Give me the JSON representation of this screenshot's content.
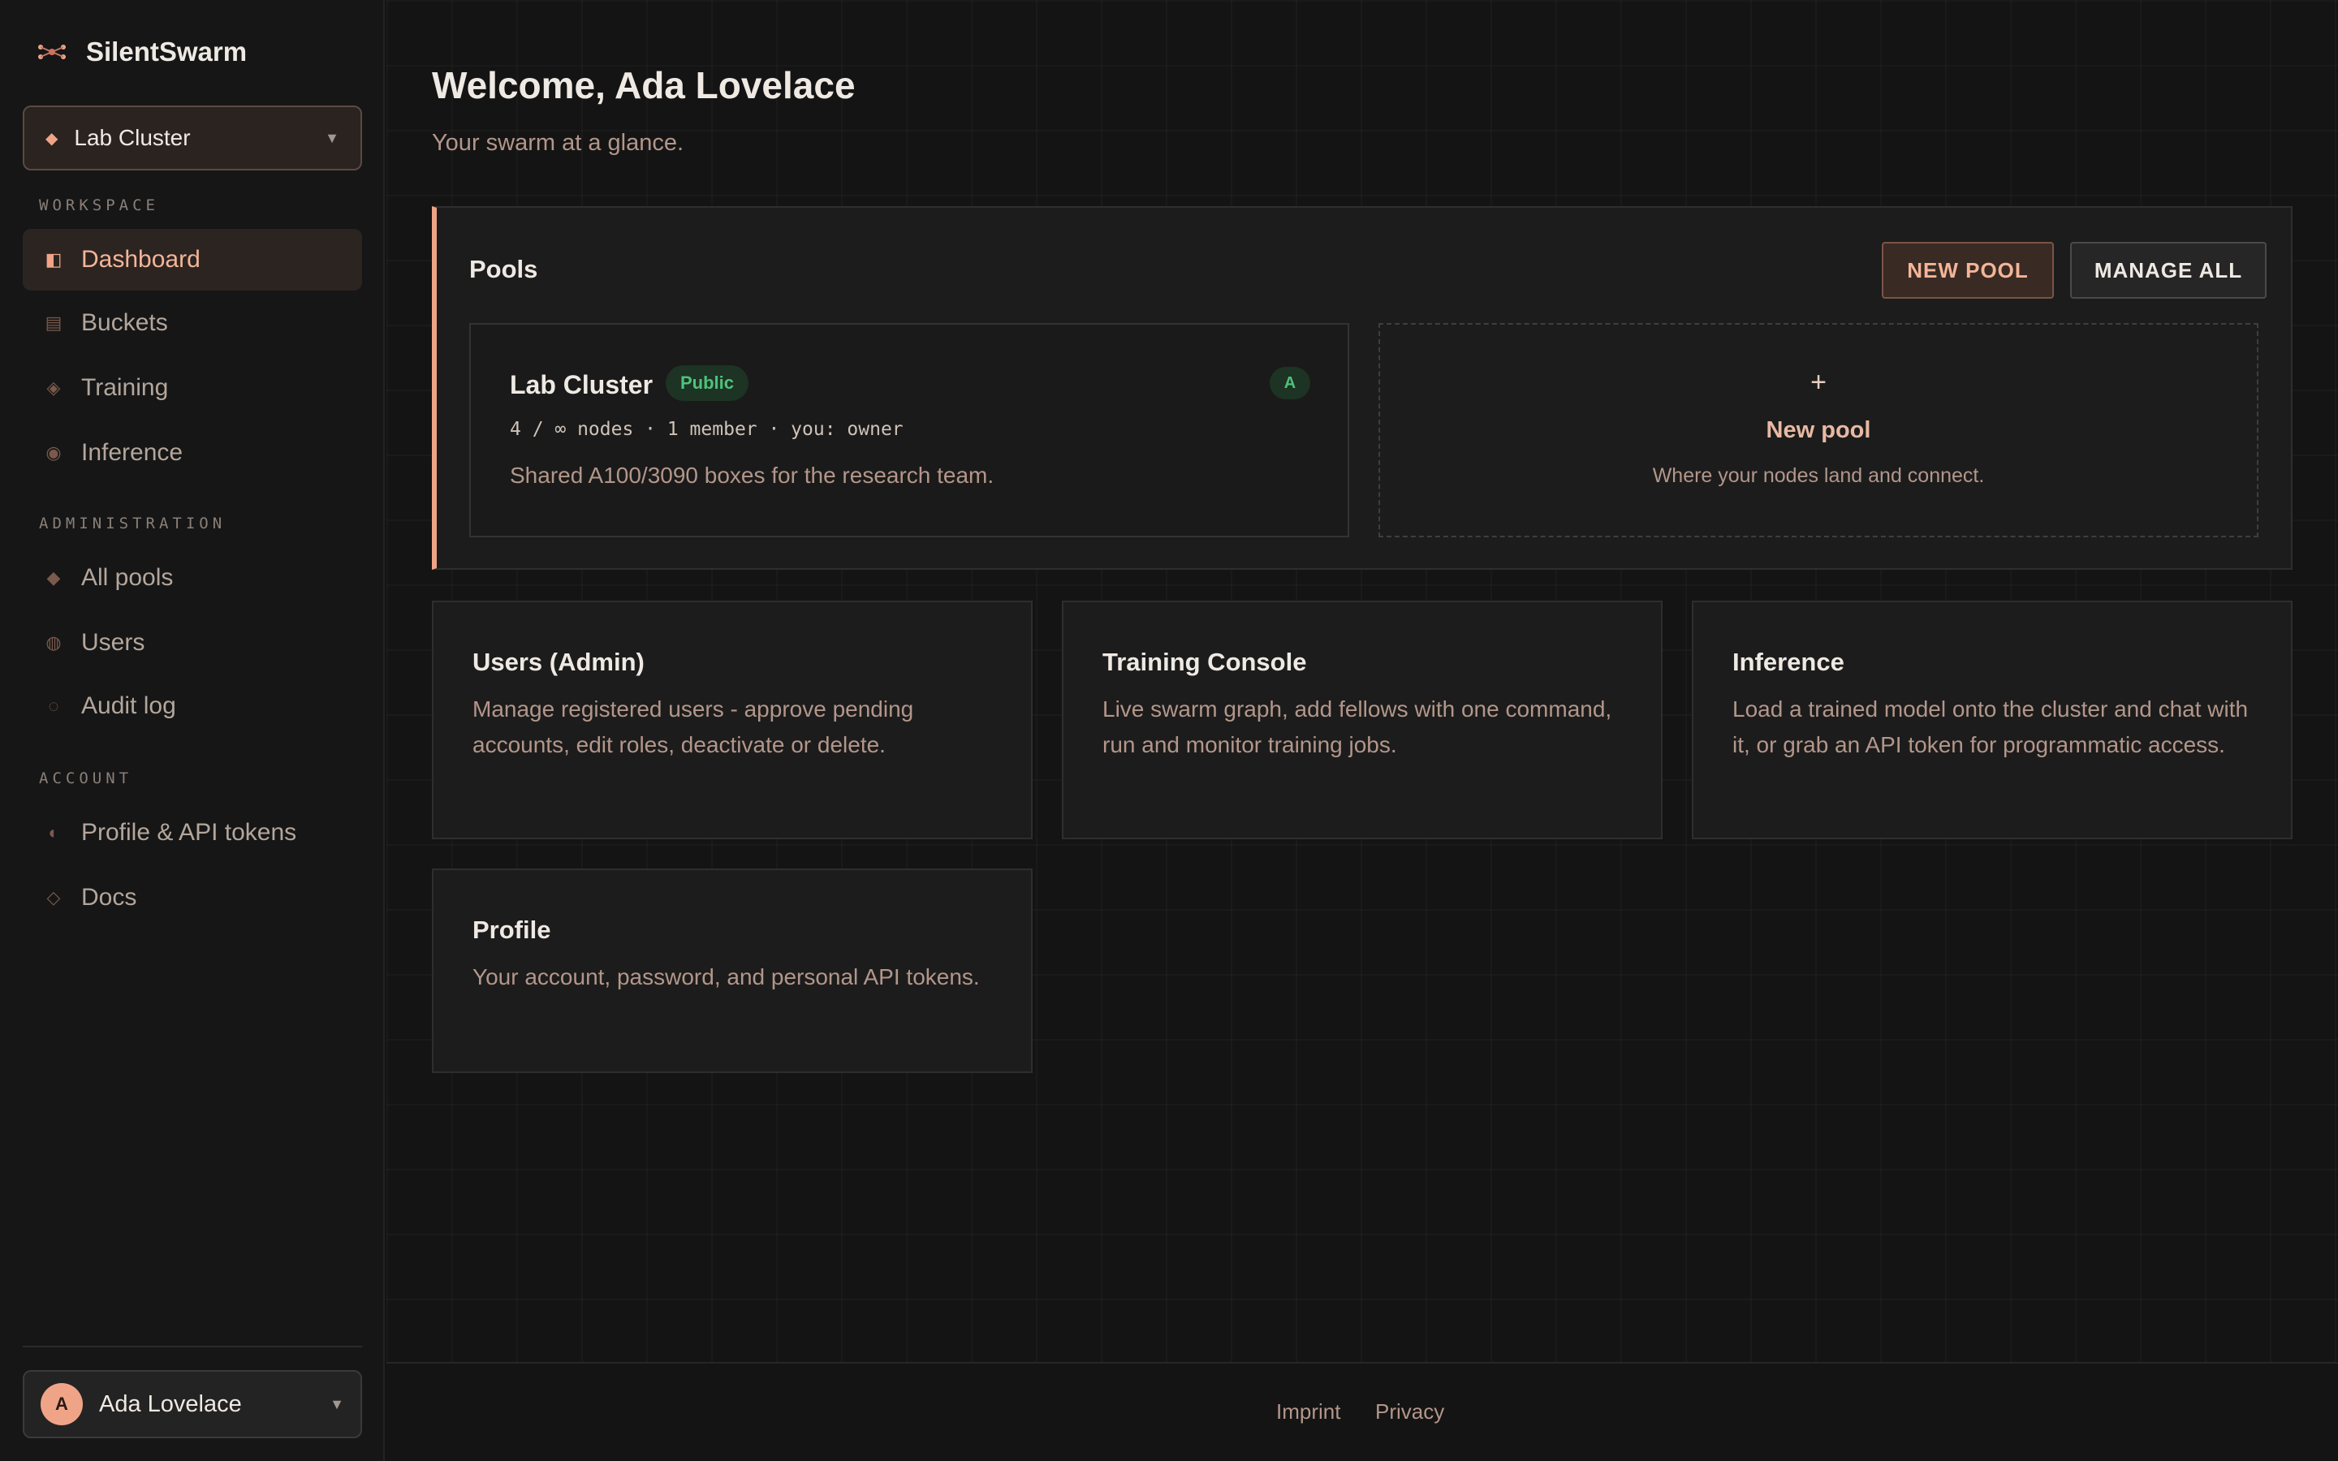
{
  "brand": {
    "name": "SilentSwarm",
    "icon": "swarm-icon",
    "accent": "#f0a487"
  },
  "cluster_select": {
    "value": "Lab Cluster",
    "icon": "diamond-icon"
  },
  "sidebar": {
    "sections": {
      "workspace": "WORKSPACE",
      "administration": "ADMINISTRATION",
      "account": "ACCOUNT"
    },
    "items": [
      {
        "label": "Dashboard",
        "icon": "dashboard-icon",
        "active": true
      },
      {
        "label": "Buckets",
        "icon": "bucket-icon"
      },
      {
        "label": "Training",
        "icon": "training-icon"
      },
      {
        "label": "Inference",
        "icon": "inference-icon"
      },
      {
        "label": "All pools",
        "icon": "pools-icon"
      },
      {
        "label": "Users",
        "icon": "users-icon"
      },
      {
        "label": "Audit log",
        "icon": "audit-icon"
      },
      {
        "label": "Profile & API tokens",
        "icon": "profile-icon"
      },
      {
        "label": "Docs",
        "icon": "docs-icon"
      }
    ]
  },
  "user": {
    "initial": "A",
    "name": "Ada Lovelace"
  },
  "header": {
    "title": "Welcome, Ada Lovelace",
    "subtitle": "Your swarm at a glance."
  },
  "pools": {
    "title": "Pools",
    "new_button": "NEW POOL",
    "manage_button": "MANAGE ALL",
    "items": [
      {
        "name": "Lab Cluster",
        "visibility": "Public",
        "member_badge": "A",
        "meta": "4 / ∞ nodes · 1 member · you: owner",
        "description": "Shared A100/3090 boxes for the research team."
      }
    ],
    "new_tile": {
      "plus": "+",
      "title": "New pool",
      "subtitle": "Where your nodes land and connect."
    }
  },
  "cards": [
    {
      "title": "Users (Admin)",
      "body": "Manage registered users - approve pending accounts, edit roles, deactivate or delete."
    },
    {
      "title": "Training Console",
      "body": "Live swarm graph, add fellows with one command, run and monitor training jobs."
    },
    {
      "title": "Inference",
      "body": "Load a trained model onto the cluster and chat with it, or grab an API token for programmatic access."
    },
    {
      "title": "Profile",
      "body": "Your account, password, and personal API tokens."
    }
  ],
  "footer": {
    "imprint": "Imprint",
    "privacy": "Privacy"
  }
}
